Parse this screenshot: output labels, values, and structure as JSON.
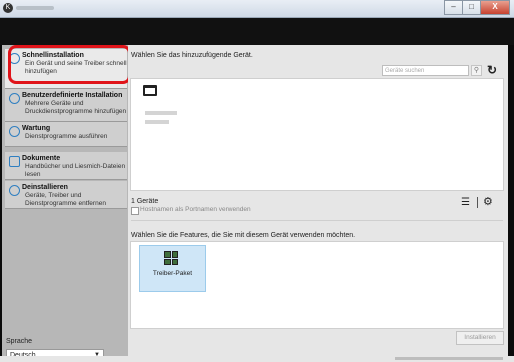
{
  "window": {
    "min": "–",
    "max": "□",
    "close": "X"
  },
  "sidebar": {
    "items": [
      {
        "title": "Schnellinstallation",
        "desc": "Ein Gerät und seine Treiber schnell hinzufügen",
        "icon": "quick-install-icon"
      },
      {
        "title": "Benutzerdefinierte Installation",
        "desc": "Mehrere Geräte und Druckdienstprogramme hinzufügen",
        "icon": "custom-install-icon"
      },
      {
        "title": "Wartung",
        "desc": "Dienstprogramme ausführen",
        "icon": "maintenance-icon"
      },
      {
        "title": "Dokumente",
        "desc": "Handbücher und Liesmich-Dateien lesen",
        "icon": "documents-icon"
      },
      {
        "title": "Deinstallieren",
        "desc": "Geräte, Treiber und Dienstprogramme entfernen",
        "icon": "uninstall-icon"
      }
    ],
    "language_label": "Sprache",
    "language_value": "Deutsch"
  },
  "main": {
    "select_device_heading": "Wählen Sie das hinzuzufügende Gerät.",
    "search_placeholder": "Geräte suchen",
    "device_count": "1 Geräte",
    "hostname_checkbox_label": "Hostnamen als Portnamen verwenden",
    "features_heading": "Wählen Sie die Features, die Sie mit diesem Gerät verwenden möchten.",
    "feature_tiles": [
      {
        "label": "Treiber-Paket",
        "icon": "driver-package-icon"
      }
    ],
    "install_button": "Installieren"
  },
  "colors": {
    "highlight": "#e0141a",
    "selected_tile": "#cfe6f7",
    "sidebar": "#b7b7b7"
  }
}
